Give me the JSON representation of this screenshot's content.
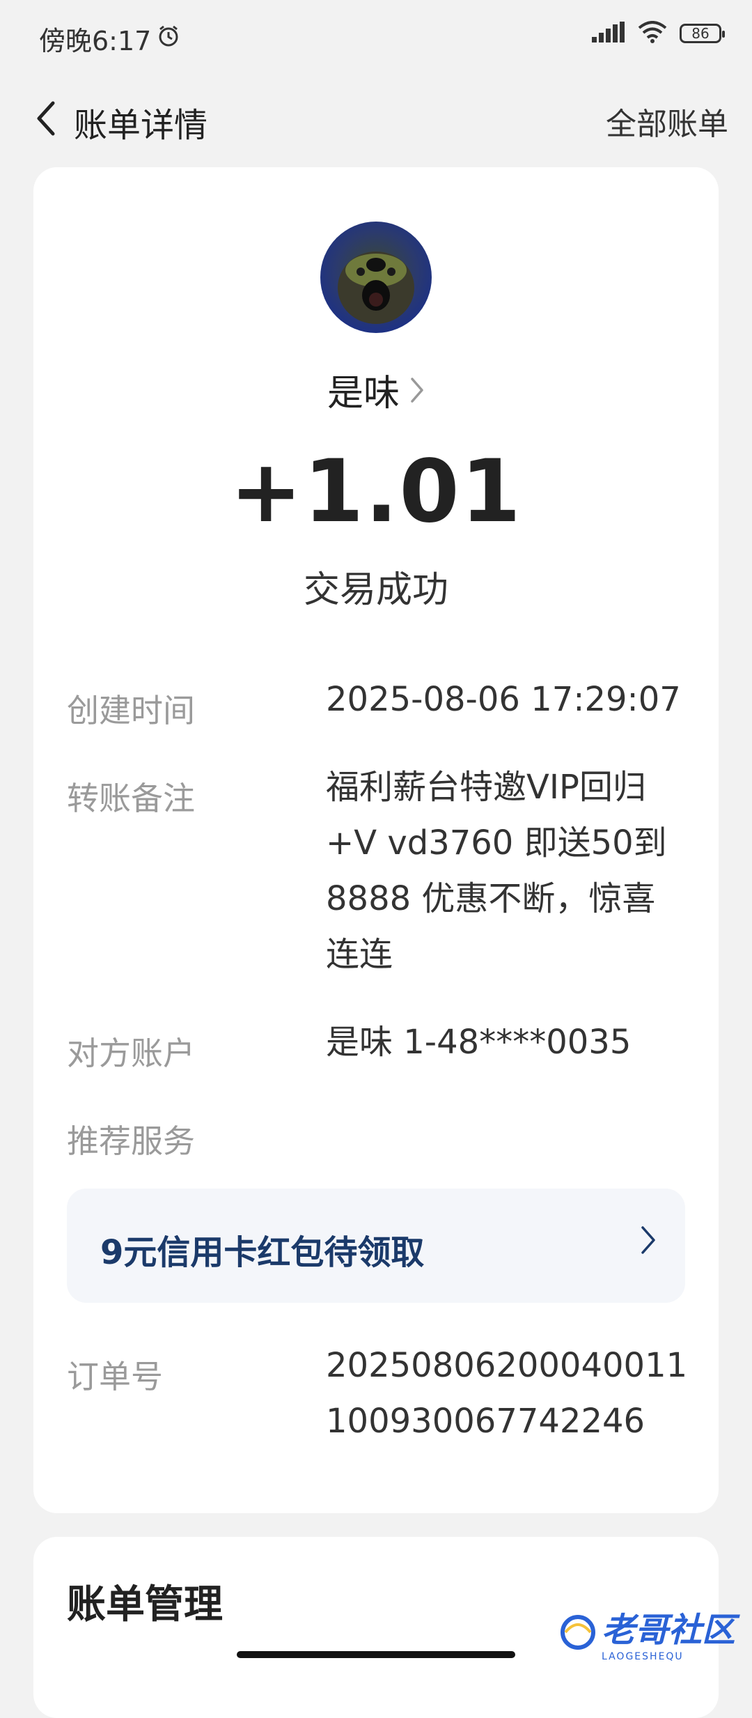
{
  "statusbar": {
    "time": "傍晚6:17",
    "battery": "86"
  },
  "header": {
    "title": "账单详情",
    "right_link": "全部账单"
  },
  "transaction": {
    "payee": "是味",
    "amount": "+1.01",
    "status": "交易成功"
  },
  "details": {
    "created_label": "创建时间",
    "created_value": "2025-08-06 17:29:07",
    "memo_label": "转账备注",
    "memo_value_lines": [
      "福利薪台特邀VIP回归",
      "+V vd3760 即送50到",
      "8888 优惠不断，惊喜",
      "连连"
    ],
    "account_label": "对方账户",
    "account_value": "是味 1-48****0035",
    "recommend_label": "推荐服务",
    "promo_text": "9元信用卡红包待领取",
    "order_label": "订单号",
    "order_value_lines": [
      "20250806200040011",
      "100930067742246"
    ]
  },
  "manage": {
    "title": "账单管理"
  },
  "watermark": {
    "text": "老哥社区",
    "subtext": "LAOGESHEQU"
  },
  "colors": {
    "accent": "#1b3a6a",
    "background": "#f2f2f2",
    "card": "#ffffff"
  }
}
